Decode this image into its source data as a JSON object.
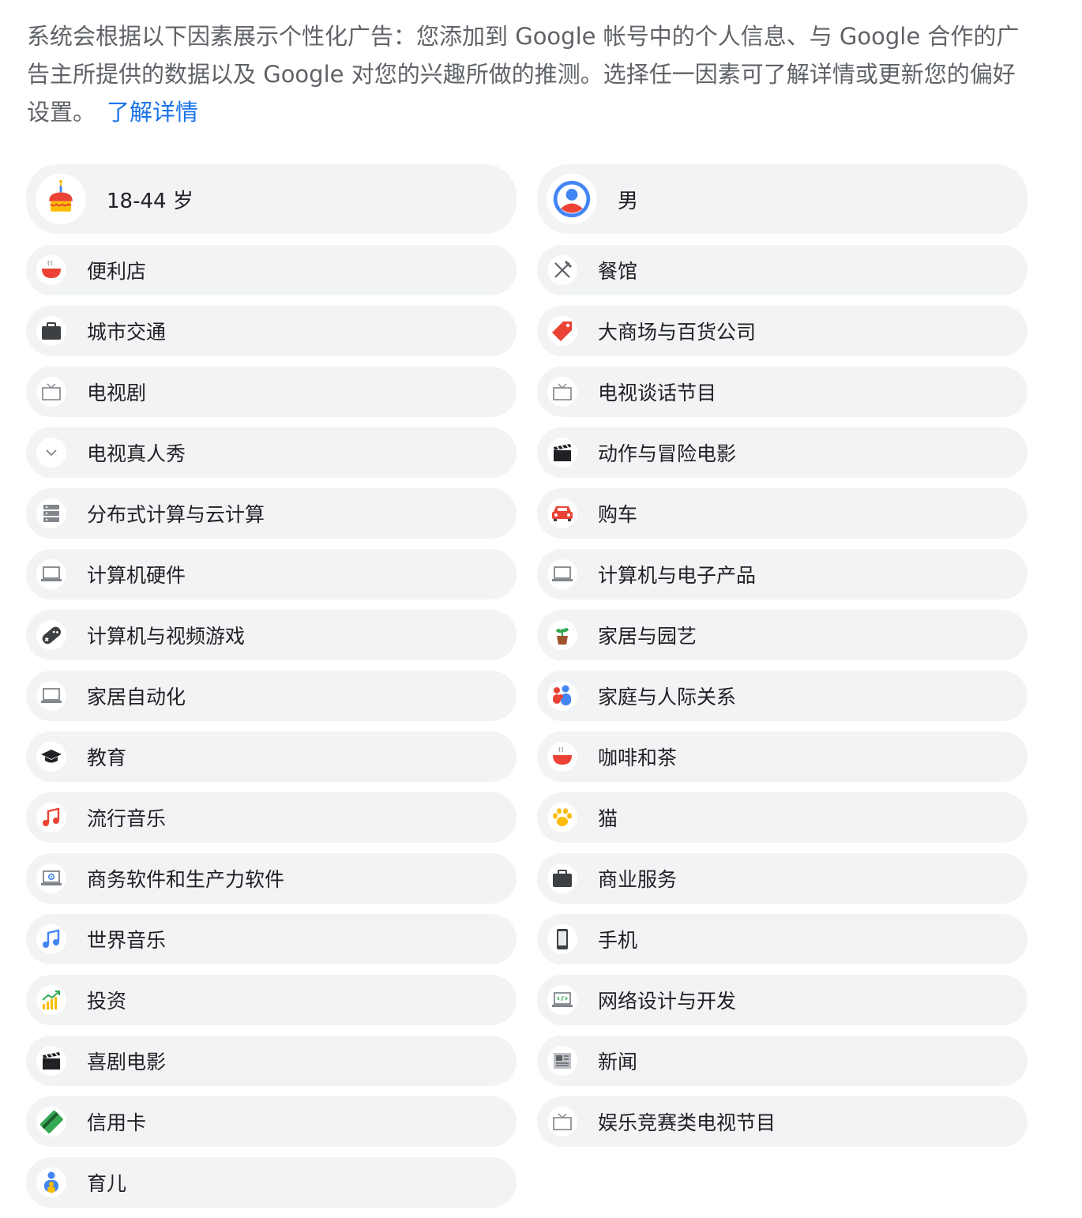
{
  "intro": {
    "text": "系统会根据以下因素展示个性化广告：您添加到 Google 帐号中的个人信息、与 Google 合作的广告主所提供的数据以及 Google 对您的兴趣所做的推测。选择任一因素可了解详情或更新您的偏好设置。",
    "link": "了解详情"
  },
  "factors": [
    {
      "label": "18-44 岁",
      "icon": "birthday-cake-icon"
    },
    {
      "label": "男",
      "icon": "person-icon"
    },
    {
      "label": "便利店",
      "icon": "bowl-icon"
    },
    {
      "label": "餐馆",
      "icon": "cutlery-icon"
    },
    {
      "label": "城市交通",
      "icon": "briefcase-icon"
    },
    {
      "label": "大商场与百货公司",
      "icon": "tag-icon"
    },
    {
      "label": "电视剧",
      "icon": "tv-icon"
    },
    {
      "label": "电视谈话节目",
      "icon": "tv-icon"
    },
    {
      "label": "电视真人秀",
      "icon": "chevron-icon"
    },
    {
      "label": "动作与冒险电影",
      "icon": "clapperboard-icon"
    },
    {
      "label": "分布式计算与云计算",
      "icon": "server-icon"
    },
    {
      "label": "购车",
      "icon": "car-icon"
    },
    {
      "label": "计算机硬件",
      "icon": "laptop-icon"
    },
    {
      "label": "计算机与电子产品",
      "icon": "laptop-icon"
    },
    {
      "label": "计算机与视频游戏",
      "icon": "gamepad-icon"
    },
    {
      "label": "家居与园艺",
      "icon": "plant-icon"
    },
    {
      "label": "家居自动化",
      "icon": "laptop-icon"
    },
    {
      "label": "家庭与人际关系",
      "icon": "family-icon"
    },
    {
      "label": "教育",
      "icon": "graduation-cap-icon"
    },
    {
      "label": "咖啡和茶",
      "icon": "bowl-icon"
    },
    {
      "label": "流行音乐",
      "icon": "music-note-red-icon"
    },
    {
      "label": "猫",
      "icon": "paw-icon"
    },
    {
      "label": "商务软件和生产力软件",
      "icon": "laptop-gear-icon"
    },
    {
      "label": "商业服务",
      "icon": "briefcase-icon"
    },
    {
      "label": "世界音乐",
      "icon": "music-note-blue-icon"
    },
    {
      "label": "手机",
      "icon": "phone-icon"
    },
    {
      "label": "投资",
      "icon": "chart-growth-icon"
    },
    {
      "label": "网络设计与开发",
      "icon": "laptop-code-icon"
    },
    {
      "label": "喜剧电影",
      "icon": "clapperboard-icon"
    },
    {
      "label": "新闻",
      "icon": "newspaper-icon"
    },
    {
      "label": "信用卡",
      "icon": "credit-card-icon"
    },
    {
      "label": "娱乐竞赛类电视节目",
      "icon": "tv-icon"
    },
    {
      "label": "育儿",
      "icon": "parent-child-icon"
    }
  ],
  "colors": {
    "link": "#1a73e8",
    "chip_bg": "#f1f3f4",
    "text": "#202124",
    "muted": "#5f6368"
  }
}
